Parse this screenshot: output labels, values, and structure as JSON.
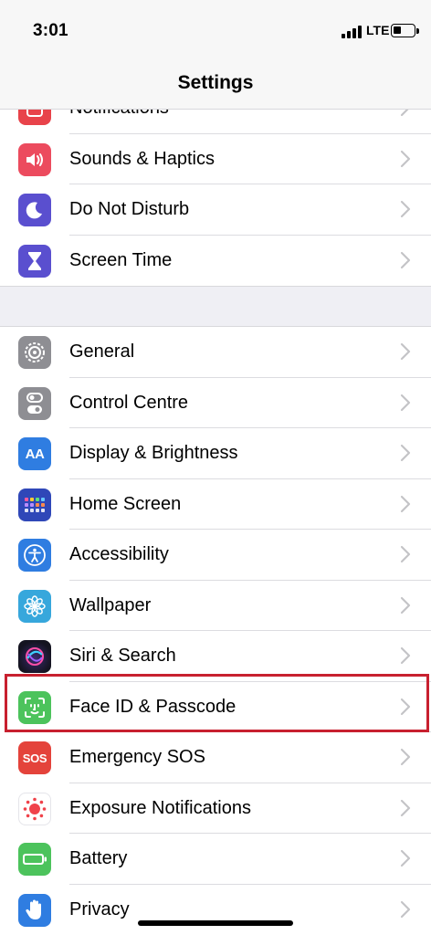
{
  "status": {
    "time": "3:01",
    "network": "LTE",
    "battery_level": 0.4
  },
  "nav": {
    "title": "Settings"
  },
  "group1": [
    {
      "label": "Notifications",
      "icon": "notifications-icon",
      "color": "#e8434a"
    },
    {
      "label": "Sounds & Haptics",
      "icon": "speaker-icon",
      "color": "#ec4b5e"
    },
    {
      "label": "Do Not Disturb",
      "icon": "moon-icon",
      "color": "#5a4fcf"
    },
    {
      "label": "Screen Time",
      "icon": "hourglass-icon",
      "color": "#5a4fcf"
    }
  ],
  "group2": [
    {
      "label": "General",
      "icon": "gear-icon",
      "color": "#8e8e93"
    },
    {
      "label": "Control Centre",
      "icon": "toggles-icon",
      "color": "#8e8e93"
    },
    {
      "label": "Display & Brightness",
      "icon": "text-size-icon",
      "color": "#2f7de1",
      "glyph": "AA"
    },
    {
      "label": "Home Screen",
      "icon": "app-grid-icon",
      "color": "#2f47b8"
    },
    {
      "label": "Accessibility",
      "icon": "accessibility-icon",
      "color": "#2f7de1"
    },
    {
      "label": "Wallpaper",
      "icon": "flower-icon",
      "color": "#37a7dc"
    },
    {
      "label": "Siri & Search",
      "icon": "siri-icon",
      "color": "#1c1c2e"
    },
    {
      "label": "Face ID & Passcode",
      "icon": "face-id-icon",
      "color": "#4cc35c"
    },
    {
      "label": "Emergency SOS",
      "icon": "sos-icon",
      "color": "#e4433b",
      "glyph": "SOS"
    },
    {
      "label": "Exposure Notifications",
      "icon": "exposure-icon",
      "color": "#ffffff"
    },
    {
      "label": "Battery",
      "icon": "battery-icon",
      "color": "#4cc35c"
    },
    {
      "label": "Privacy",
      "icon": "hand-icon",
      "color": "#2f7de1"
    }
  ],
  "highlighted_item": "Face ID & Passcode",
  "highlight_color": "#c8202f"
}
